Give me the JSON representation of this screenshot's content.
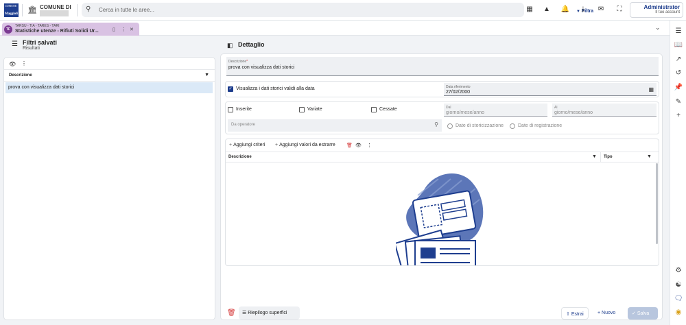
{
  "header": {
    "logo_line1": "COMUNE",
    "logo_line2": "Maggioli",
    "comune_label": "COMUNE DI",
    "search_placeholder": "Cerca in tutte le aree...",
    "filter_label": "Filtra",
    "user_name": "Administrator",
    "user_sub": "Il tuo account"
  },
  "tab": {
    "badge": "TF",
    "subtitle": "TARSU - TIA - TARES - TARI",
    "title": "Statistiche utenze - Rifiuti Solidi Ur..."
  },
  "left_panel": {
    "title": "Filtri salvati",
    "subtitle": "Risultati",
    "column_header": "Descrizione",
    "rows": [
      "prova con visualizza dati storici"
    ]
  },
  "detail": {
    "title": "Dettaglio",
    "description_label": "Descrizione",
    "description_value": "prova con visualizza dati storici",
    "historic_checkbox_label": "Visualizza i dati storici validi alla data",
    "historic_checked": true,
    "ref_date_label": "Data riferimento",
    "ref_date_value": "27/02/2000",
    "checkbox_inserite": "Inserite",
    "checkbox_variate": "Variate",
    "checkbox_cessate": "Cessate",
    "date_from_label": "Dal",
    "date_from_placeholder": "giorno/mese/anno",
    "date_to_label": "Al",
    "date_to_placeholder": "giorno/mese/anno",
    "operator_placeholder": "Da operatore",
    "radio_storicizzazione": "Date di storicizzazione",
    "radio_registrazione": "Date di registrazione",
    "toolbar": {
      "add_criteria": "Aggiungi criteri",
      "add_values": "Aggiungi valori da estrarre"
    },
    "table_columns": [
      "Descrizione",
      "Tipo"
    ]
  },
  "footer": {
    "summary_button": "Riepilogo superfici",
    "extract_button": "Estrai",
    "new_button": "Nuovo",
    "save_button": "Salva"
  },
  "colors": {
    "accent": "#1c3c8c",
    "tab_bg": "#d9c2e3",
    "selected_row": "#dbe9f7",
    "danger": "#d32f2f"
  }
}
